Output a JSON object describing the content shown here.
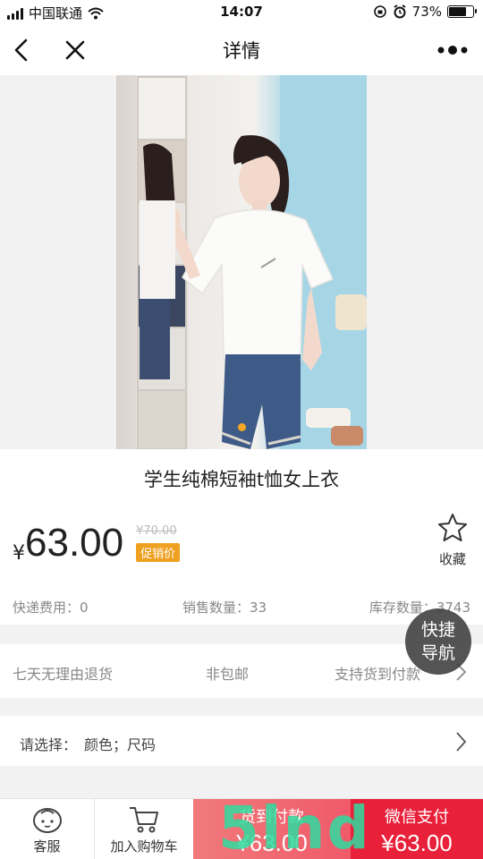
{
  "status_bar": {
    "carrier": "中国联通",
    "time": "14:07",
    "battery": "73%",
    "battery_level": 0.73
  },
  "nav": {
    "title": "详情"
  },
  "product": {
    "title": "学生纯棉短袖t恤女上衣",
    "currency": "¥",
    "price": "63.00",
    "original_price": "¥70.00",
    "promo_badge": "促销价",
    "favorite_label": "收藏",
    "shipping": "快递费用：0",
    "sales": "销售数量：33",
    "stock": "库存数量：3743"
  },
  "services": {
    "return_policy": "七天无理由退货",
    "shipping_type": "非包邮",
    "cod": "支持货到付款"
  },
  "options": {
    "label": "请选择：",
    "value": "颜色；尺码"
  },
  "quick_nav": {
    "line1": "快捷",
    "line2": "导航"
  },
  "bottom_bar": {
    "service_label": "客服",
    "cart_label": "加入购物车",
    "cod_label": "货到付款",
    "cod_price": "¥63.00",
    "wechat_label": "微信支付",
    "wechat_price": "¥63.00"
  },
  "watermark": "5lnd",
  "colors": {
    "promo": "#f0a020",
    "cod_button": "#f05a6a",
    "wechat_button": "#e8203a",
    "carousel_dot": "#f5a623"
  }
}
